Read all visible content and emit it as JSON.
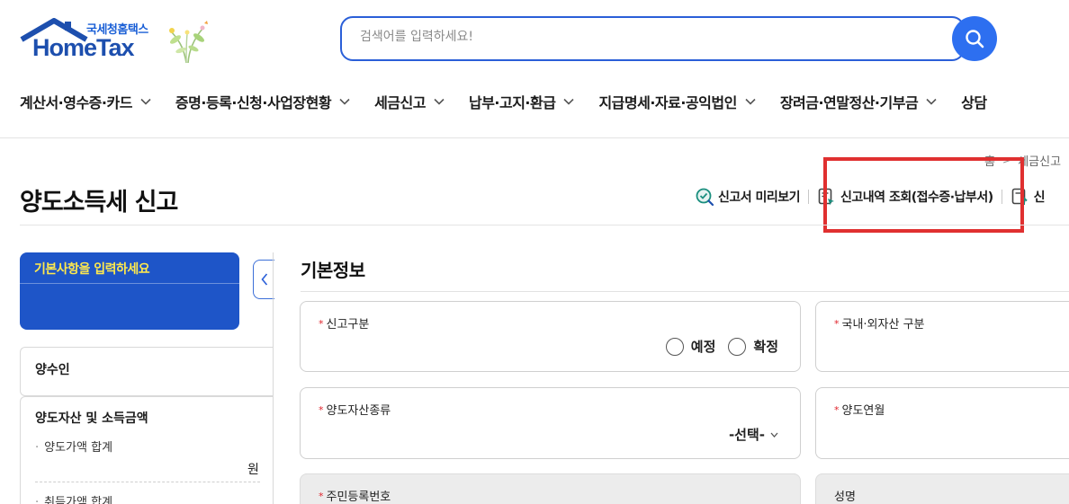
{
  "header": {
    "logo_sub": "국세청홈택스",
    "logo_main": "HomeTax",
    "search_placeholder": "검색어를 입력하세요!"
  },
  "nav": [
    {
      "label": "계산서·영수증·카드"
    },
    {
      "label": "증명·등록·신청·사업장현황"
    },
    {
      "label": "세금신고"
    },
    {
      "label": "납부·고지·환급"
    },
    {
      "label": "지급명세·자료·공익법인"
    },
    {
      "label": "장려금·연말정산·기부금"
    },
    {
      "label": "상담"
    }
  ],
  "breadcrumb": {
    "home": "홈",
    "current": "세금신고"
  },
  "page": {
    "title": "양도소득세 신고",
    "actions": [
      {
        "label": "신고서 미리보기"
      },
      {
        "label": "신고내역 조회(접수증·납부서)"
      },
      {
        "label": "신"
      }
    ]
  },
  "sidebar": {
    "card_title": "기본사항을 입력하세요",
    "sections": [
      {
        "label": "양수인"
      },
      {
        "label": "양도자산 및 소득금액",
        "items": [
          {
            "label": "양도가액 합계",
            "unit": "원"
          },
          {
            "label": "취득가액 합계"
          }
        ]
      }
    ]
  },
  "form": {
    "section_title": "기본정보",
    "report_type": {
      "label": "신고구분",
      "options": [
        "예정",
        "확정"
      ]
    },
    "asset_domestic": {
      "label": "국내·외자산 구분"
    },
    "asset_kind": {
      "label": "양도자산종류",
      "value": "-선택-"
    },
    "transfer_month": {
      "label": "양도연월"
    },
    "resident_no": {
      "label": "주민등록번호"
    },
    "name": {
      "label": "성명"
    }
  },
  "colors": {
    "brand_blue": "#1e55c8",
    "highlight_red": "#e03030",
    "search_blue": "#2d6ff0"
  }
}
